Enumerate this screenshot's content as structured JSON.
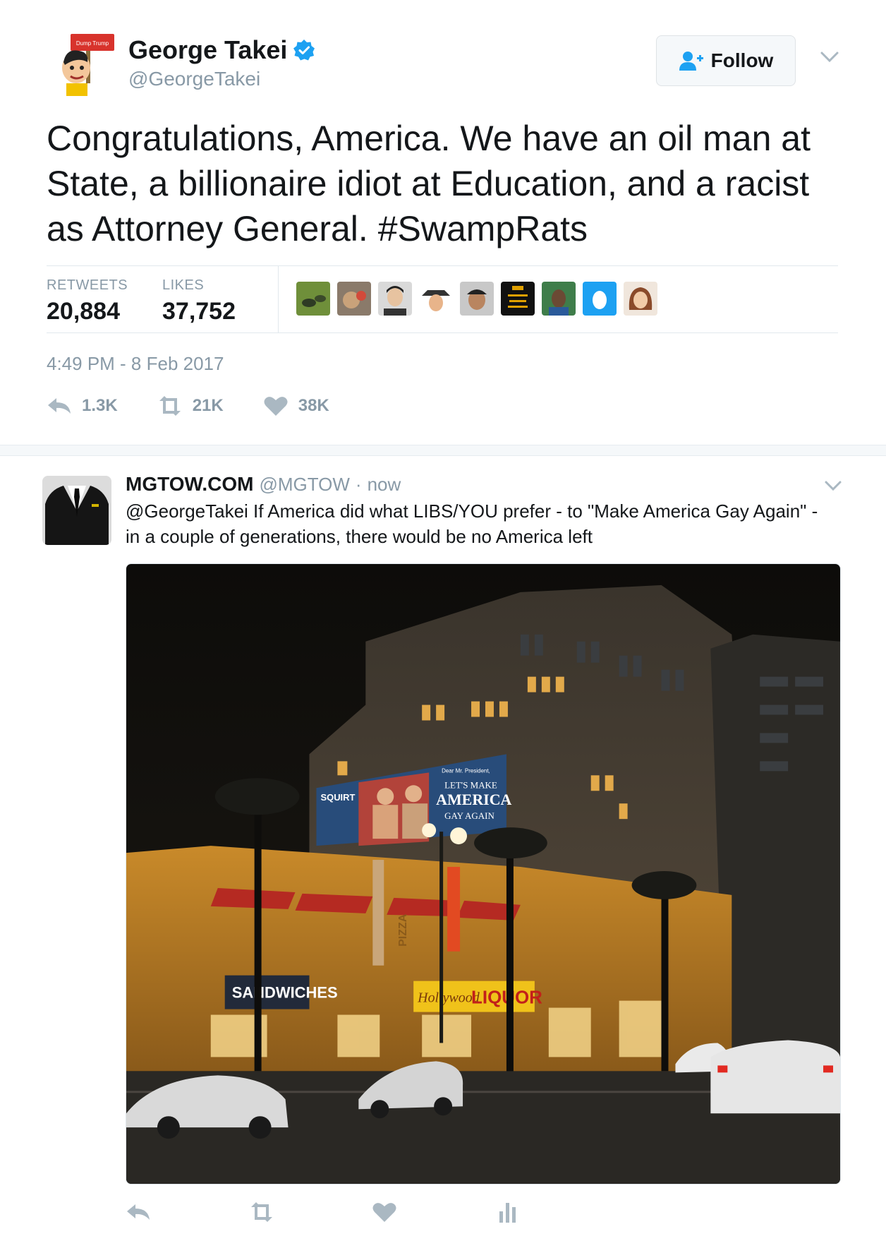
{
  "main_tweet": {
    "author": {
      "name": "George Takei",
      "handle": "@GeorgeTakei",
      "avatar_sign": "Dump Trump",
      "verified": true
    },
    "follow_label": "Follow",
    "text": "Congratulations, America. We have an oil man at State, a billionaire idiot at Education, and a racist as Attorney General. #SwampRats",
    "stats": {
      "retweets_label": "RETWEETS",
      "retweets_value": "20,884",
      "likes_label": "LIKES",
      "likes_value": "37,752"
    },
    "timestamp": "4:49 PM - 8 Feb 2017",
    "actions": {
      "reply_count": "1.3K",
      "retweet_count": "21K",
      "like_count": "38K"
    }
  },
  "reply_tweet": {
    "author_name": "MGTOW.COM",
    "handle": "@MGTOW",
    "separator": "·",
    "time": "now",
    "text": "@GeorgeTakei If America did what LIBS/YOU prefer - to \"Make America Gay Again\" - in a couple of generations, there would be no America left",
    "photo": {
      "billboard_brand": "SQUIRT",
      "billboard_line1": "Dear Mr. President,",
      "billboard_line2": "LET'S MAKE",
      "billboard_line3": "AMERICA",
      "billboard_line4": "GAY AGAIN",
      "sign_pizza": "PIZZA",
      "sign_liquor": "LIQUOR",
      "sign_sandwiches": "SANDWICHES",
      "sign_hollywood": "Hollywood"
    }
  },
  "colors": {
    "text_primary": "#14171a",
    "text_secondary": "#8899a6",
    "verified_blue": "#1da1f2",
    "border": "#e1e8ed",
    "background": "#ffffff"
  },
  "icons": {
    "follow": "add-user-icon",
    "verified": "verified-badge-icon",
    "menu": "chevron-down-icon",
    "reply": "reply-icon",
    "retweet": "retweet-icon",
    "like": "heart-icon",
    "analytics": "analytics-icon"
  }
}
